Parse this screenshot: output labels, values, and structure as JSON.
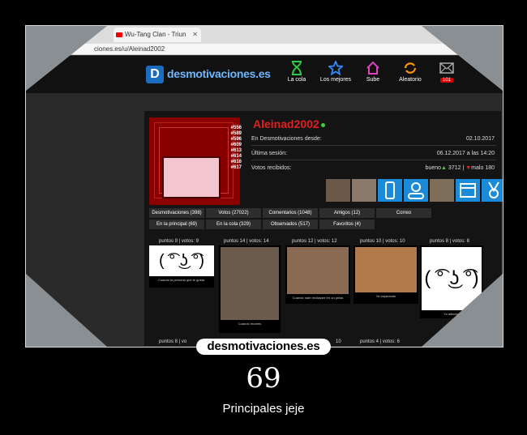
{
  "browser": {
    "tab_title": "Wu-Tang Clan - Triun",
    "tab_close": "✕",
    "address": "ciones.es/u/Aleinad2002"
  },
  "nav": {
    "logo_text": "desmotivaciones.es",
    "items": [
      {
        "label": "La cola",
        "icon": "hourglass-icon",
        "color": "#2ecc40"
      },
      {
        "label": "Los mejores",
        "icon": "star-icon",
        "color": "#2e8bff"
      },
      {
        "label": "Sube",
        "icon": "house-icon",
        "color": "#e040c0"
      },
      {
        "label": "Aleatorio",
        "icon": "shuffle-icon",
        "color": "#ff9900"
      }
    ],
    "mail_count": "101"
  },
  "profile": {
    "username": "Aleinad2002",
    "ranks": [
      "#556",
      "#589",
      "#596",
      "#609",
      "#613",
      "#614",
      "#616",
      "#617"
    ],
    "rows": [
      {
        "label": "En Desmotivaciones desde:",
        "value": "02.10.2017"
      },
      {
        "label": "Última sesión:",
        "value": "06.12.2017 a las 14:20"
      }
    ],
    "votes_label": "Votos recibidos:",
    "votes_good_label": "bueno",
    "votes_good": "3712",
    "votes_sep": "|",
    "votes_bad_label": "malo",
    "votes_bad": "180"
  },
  "tabs": [
    [
      "Desmotivaciones (398)",
      "Votos (27022)",
      "Comentarios (1048)",
      "Amigos (12)",
      "Correo"
    ],
    [
      "En la principal (69)",
      "En la cola (329)",
      "Observados (517)",
      "Favoritos (4)"
    ]
  ],
  "posts": [
    {
      "points": "puntos 9 | votos: 9",
      "face": "( ͡° ͜ʖ ͡°)"
    },
    {
      "points": "puntos 14 | votos: 14",
      "caption": "Cuando mueres"
    },
    {
      "points": "puntos 12 | votos: 12",
      "caption": "Cuando nate recilayste en un pelas"
    },
    {
      "points": "puntos 10 | votos: 10",
      "caption": "Yo esperando"
    },
    {
      "points": "puntos 8 | votos: 8",
      "face": "( ͡° ͜ʖ ͡°)"
    }
  ],
  "bottom_points": [
    "puntos 8 | vo",
    "10",
    "puntos 4 | votos: 6"
  ],
  "post_captions": {
    "first": "Cuando la persona que te gusta.",
    "last": "Yo alientas"
  },
  "banner": "desmotivaciones.es",
  "number": "69",
  "caption": "Principales jeje",
  "colors": {
    "accent": "#e02020",
    "blue": "#1b8ad8",
    "background": "#000000"
  }
}
